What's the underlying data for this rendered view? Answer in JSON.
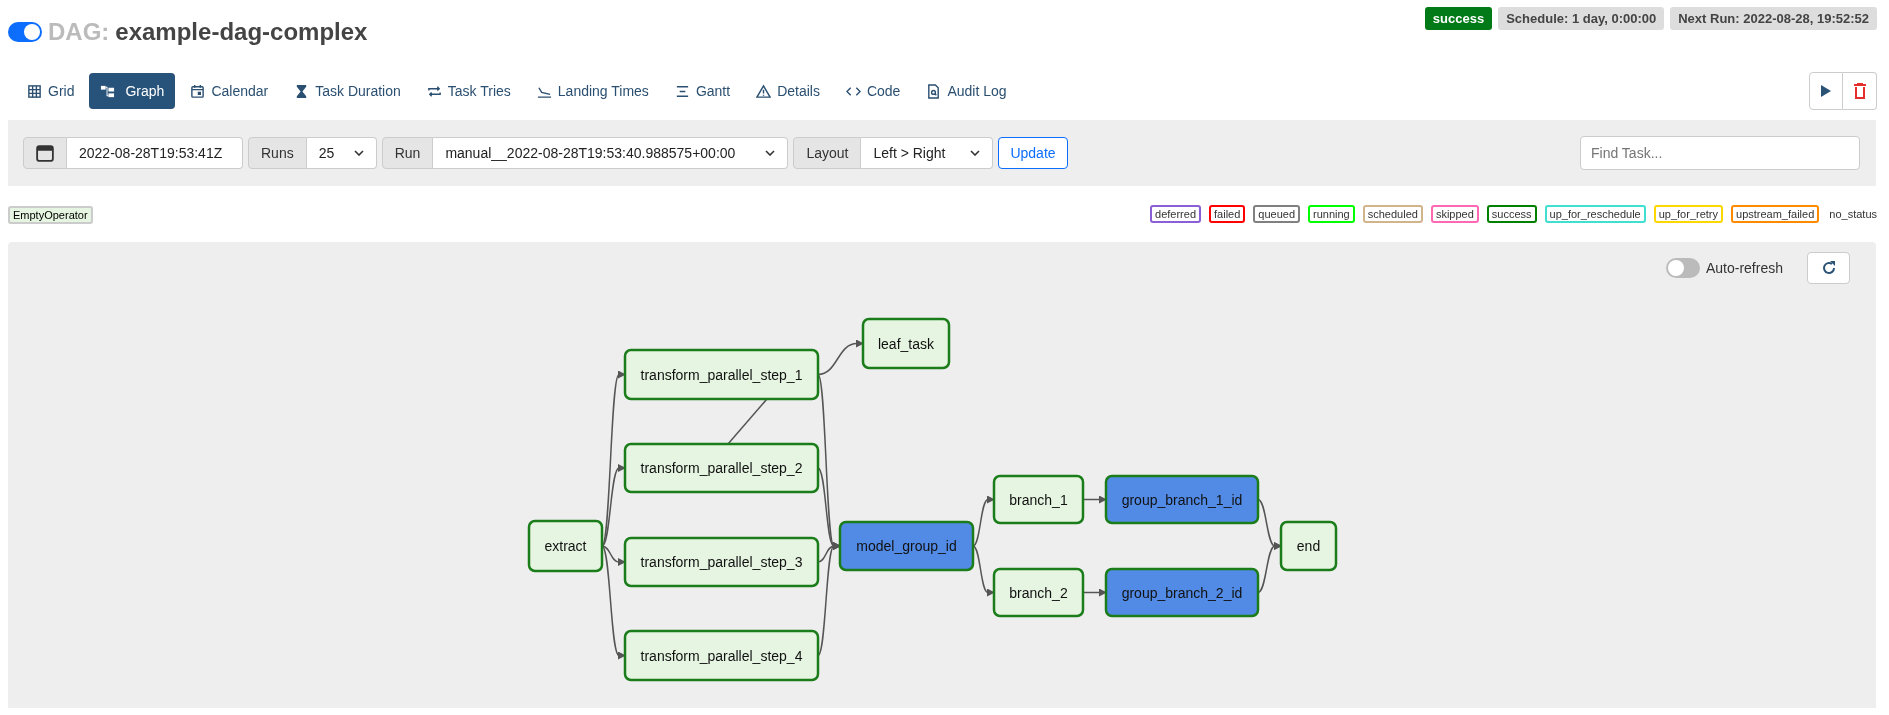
{
  "header": {
    "dag_active": true,
    "prefix": "DAG:",
    "title": "example-dag-complex",
    "state_badge": "success",
    "schedule": "Schedule: 1 day, 0:00:00",
    "next_run": "Next Run: 2022-08-28, 19:52:52"
  },
  "tabs": [
    {
      "label": "Grid",
      "kind": "grid",
      "selected": false
    },
    {
      "label": "Graph",
      "kind": "graph",
      "selected": true
    },
    {
      "label": "Calendar",
      "kind": "calendar",
      "selected": false
    },
    {
      "label": "Task Duration",
      "kind": "duration",
      "selected": false
    },
    {
      "label": "Task Tries",
      "kind": "tries",
      "selected": false
    },
    {
      "label": "Landing Times",
      "kind": "landing",
      "selected": false
    },
    {
      "label": "Gantt",
      "kind": "gantt",
      "selected": false
    },
    {
      "label": "Details",
      "kind": "details",
      "selected": false
    },
    {
      "label": "Code",
      "kind": "code",
      "selected": false
    },
    {
      "label": "Audit Log",
      "kind": "audit",
      "selected": false
    }
  ],
  "controls": {
    "date": "2022-08-28T19:53:41Z",
    "runs_label": "Runs",
    "runs_value": "25",
    "run_label": "Run",
    "run_value": "manual__2022-08-28T19:53:40.988575+00:00",
    "layout_label": "Layout",
    "layout_value": "Left > Right",
    "update": "Update",
    "find_placeholder": "Find Task..."
  },
  "operators": [
    "EmptyOperator"
  ],
  "legend": [
    {
      "label": "deferred",
      "color": "#8a5ed6"
    },
    {
      "label": "failed",
      "color": "#ff0000"
    },
    {
      "label": "queued",
      "color": "#808080"
    },
    {
      "label": "running",
      "color": "#00ff00"
    },
    {
      "label": "scheduled",
      "color": "#d2b48c"
    },
    {
      "label": "skipped",
      "color": "#ff69b4"
    },
    {
      "label": "success",
      "color": "#008000"
    },
    {
      "label": "up_for_reschedule",
      "color": "#40e0d0"
    },
    {
      "label": "up_for_retry",
      "color": "#ffd700"
    },
    {
      "label": "upstream_failed",
      "color": "#ff8c00"
    }
  ],
  "no_status": "no_status",
  "auto_refresh": {
    "label": "Auto-refresh",
    "on": false
  },
  "graph": {
    "nodes": [
      {
        "label": "extract",
        "kind": "task"
      },
      {
        "label": "transform_parallel_step_1",
        "kind": "task"
      },
      {
        "label": "transform_parallel_step_2",
        "kind": "task"
      },
      {
        "label": "transform_parallel_step_3",
        "kind": "task"
      },
      {
        "label": "transform_parallel_step_4",
        "kind": "task"
      },
      {
        "label": "leaf_task",
        "kind": "task"
      },
      {
        "label": "model_group_id",
        "kind": "group"
      },
      {
        "label": "branch_1",
        "kind": "task"
      },
      {
        "label": "branch_2",
        "kind": "task"
      },
      {
        "label": "group_branch_1_id",
        "kind": "group"
      },
      {
        "label": "group_branch_2_id",
        "kind": "group"
      },
      {
        "label": "end",
        "kind": "task"
      }
    ]
  }
}
